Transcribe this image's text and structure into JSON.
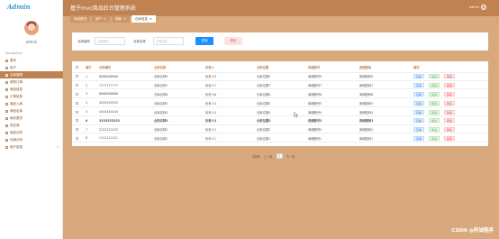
{
  "logo": "Admin",
  "sidebar": {
    "admin_label": "admin",
    "nav_heading": "Navigation",
    "items": [
      {
        "label": "首页"
      },
      {
        "label": "用户"
      },
      {
        "label": "仓库管理"
      },
      {
        "label": "采购订单"
      },
      {
        "label": "商品信息"
      },
      {
        "label": "订单信息"
      },
      {
        "label": "商品入库"
      },
      {
        "label": "商品出库"
      },
      {
        "label": "库存退货"
      },
      {
        "label": "供应商"
      },
      {
        "label": "商品分析"
      },
      {
        "label": "利润分析"
      },
      {
        "label": "用户信息"
      }
    ]
  },
  "header": {
    "title": "基于mvc商品后台管理系统",
    "user": "admin"
  },
  "tabs": [
    {
      "label": "系统首页"
    },
    {
      "label": "用户"
    },
    {
      "label": "商家"
    },
    {
      "label": "仓库信息"
    }
  ],
  "search": {
    "field1_label": "仓库编号",
    "field1_placeholder": "仓库编号",
    "field2_label": "仓库名称",
    "field2_placeholder": "仓库名称",
    "search_button": "查询",
    "delete_button": "删除"
  },
  "table": {
    "columns": [
      "索引",
      "仓库编号",
      "仓库名称",
      "负责人",
      "仓库位置",
      "库储账号",
      "库储密码",
      "操作"
    ],
    "rows": [
      [
        "1",
        "8888888888",
        "仓库名称9",
        "负责人9",
        "仓库位置9",
        "库储账号9",
        "库储密码9"
      ],
      [
        "2",
        "7777777777",
        "仓库名称7",
        "负责人7",
        "仓库位置7",
        "库储账号7",
        "库储密码7"
      ],
      [
        "3",
        "6666666666",
        "仓库名称6",
        "负责人6",
        "仓库位置6",
        "库储账号6",
        "库储密码6"
      ],
      [
        "4",
        "5555555555",
        "仓库名称5",
        "负责人5",
        "仓库位置5",
        "库储账号5",
        "库储密码5"
      ],
      [
        "5",
        "4444444444",
        "仓库名称4",
        "负责人4",
        "仓库位置4",
        "库储账号4",
        "库储密码4"
      ],
      [
        "6",
        "3333333333",
        "仓库名称3",
        "负责人3",
        "仓库位置3",
        "库储账号3",
        "库储密码3"
      ],
      [
        "7",
        "2222222222",
        "仓库名称2",
        "负责人2",
        "仓库位置2",
        "库储账号2",
        "库储密码2"
      ],
      [
        "8",
        "1111111111",
        "仓库名称1",
        "负责人1",
        "仓库位置1",
        "库储账号1",
        "库储密码1"
      ]
    ],
    "actions": {
      "view": "查看",
      "edit": "修改",
      "delete": "删除"
    }
  },
  "pager": {
    "total": "共8条",
    "prev": "上一页",
    "page": "1",
    "next": "下一页"
  },
  "watermark": "CSDN @阿诚程序"
}
